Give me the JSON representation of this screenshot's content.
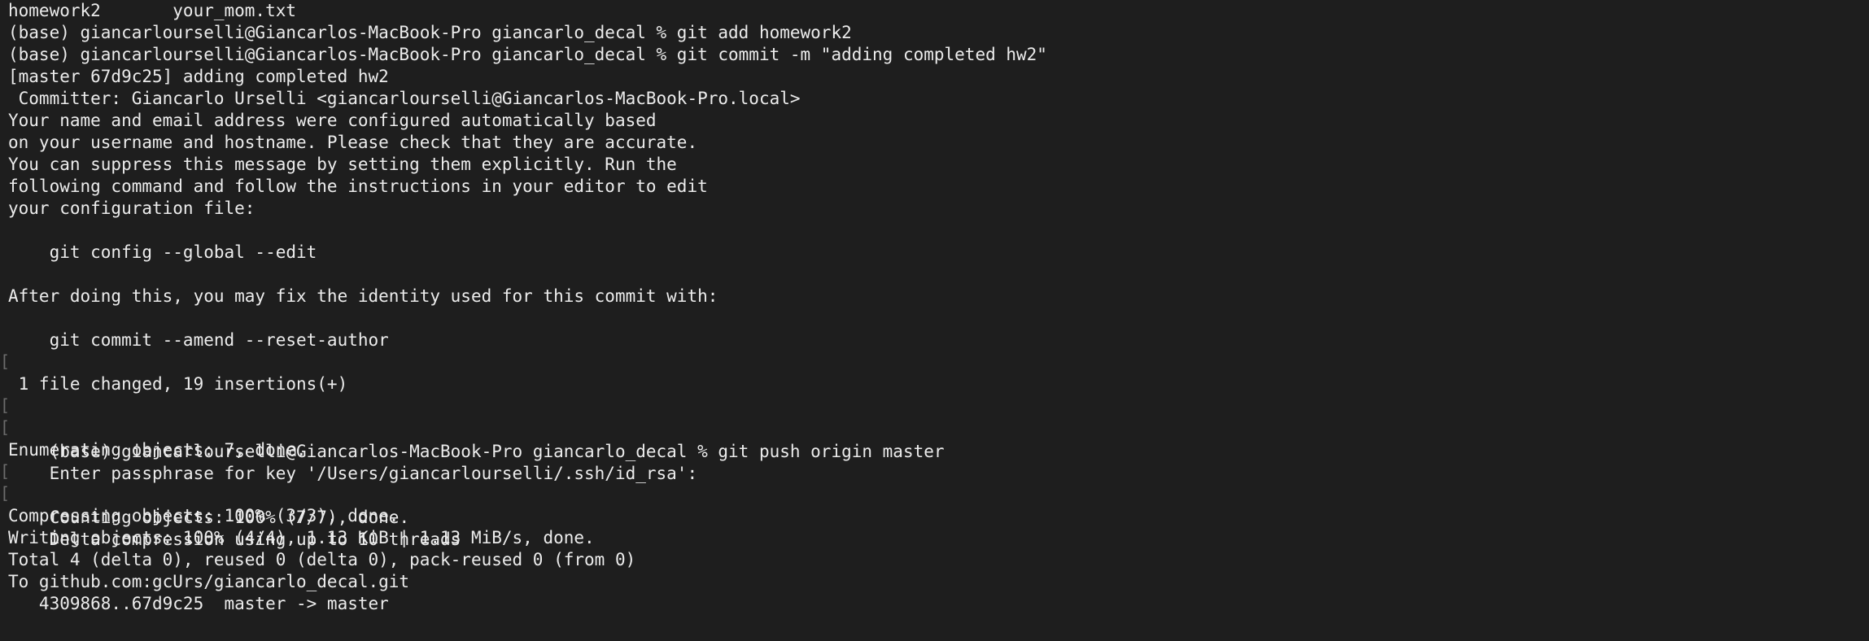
{
  "terminal": {
    "lines": [
      {
        "text": "homework2       your_mom.txt"
      },
      {
        "text": "(base) giancarlourselli@Giancarlos-MacBook-Pro giancarlo_decal % git add homework2"
      },
      {
        "text": "(base) giancarlourselli@Giancarlos-MacBook-Pro giancarlo_decal % git commit -m \"adding completed hw2\""
      },
      {
        "text": "[master 67d9c25] adding completed hw2"
      },
      {
        "text": " Committer: Giancarlo Urselli <giancarlourselli@Giancarlos-MacBook-Pro.local>"
      },
      {
        "text": "Your name and email address were configured automatically based"
      },
      {
        "text": "on your username and hostname. Please check that they are accurate."
      },
      {
        "text": "You can suppress this message by setting them explicitly. Run the"
      },
      {
        "text": "following command and follow the instructions in your editor to edit"
      },
      {
        "text": "your configuration file:"
      },
      {
        "text": ""
      },
      {
        "text": "    git config --global --edit"
      },
      {
        "text": ""
      },
      {
        "text": "After doing this, you may fix the identity used for this commit with:"
      },
      {
        "text": ""
      },
      {
        "text": "    git commit --amend --reset-author"
      },
      {
        "text": ""
      },
      {
        "text": " 1 file changed, 19 insertions(+)"
      },
      {
        "text": "(base) giancarlourselli@Giancarlos-MacBook-Pro giancarlo_decal % git push origin master"
      },
      {
        "text": "Enter passphrase for key '/Users/giancarlourselli/.ssh/id_rsa':"
      },
      {
        "text": "Enumerating objects: 7, done."
      },
      {
        "text": "Counting objects: 100% (7/7), done."
      },
      {
        "text": "Delta compression using up to 10 threads"
      },
      {
        "text": "Compressing objects: 100% (3/3), done."
      },
      {
        "text": "Writing objects: 100% (4/4), 1.13 KiB | 1.13 MiB/s, done."
      },
      {
        "text": "Total 4 (delta 0), reused 0 (delta 0), pack-reused 0 (from 0)"
      },
      {
        "text": "To github.com:gcUrs/giancarlo_decal.git"
      },
      {
        "text": "   4309868..67d9c25  master -> master"
      }
    ],
    "mark_glyph": "["
  }
}
